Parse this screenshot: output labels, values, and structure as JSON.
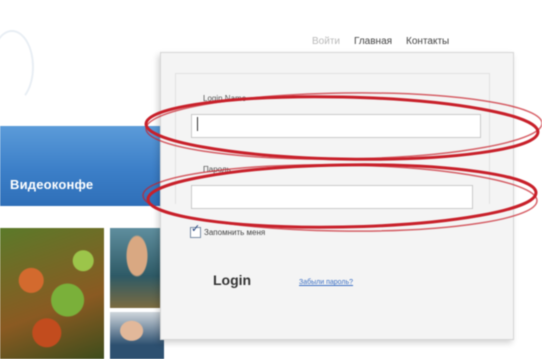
{
  "top_nav": {
    "items": [
      {
        "label": "Войти",
        "state": "disabled"
      },
      {
        "label": "Главная",
        "state": "active"
      },
      {
        "label": "Контакты",
        "state": "active"
      }
    ]
  },
  "banner": {
    "title": "Видеоконфе"
  },
  "login_form": {
    "login_name_label": "Login Name",
    "login_name_value": "",
    "password_label": "Пароль",
    "password_value": "",
    "remember_label": "Запомнить меня",
    "remember_checked": true,
    "submit_label": "Login",
    "forgot_link": "Забыли пароль?"
  },
  "icons": {
    "checkbox_check": "checkmark-icon"
  },
  "colors": {
    "banner_blue": "#3c7fc8",
    "annotation_red": "#c8202a",
    "link_blue": "#3b6fc4",
    "panel_bg": "#f4f4f4"
  }
}
